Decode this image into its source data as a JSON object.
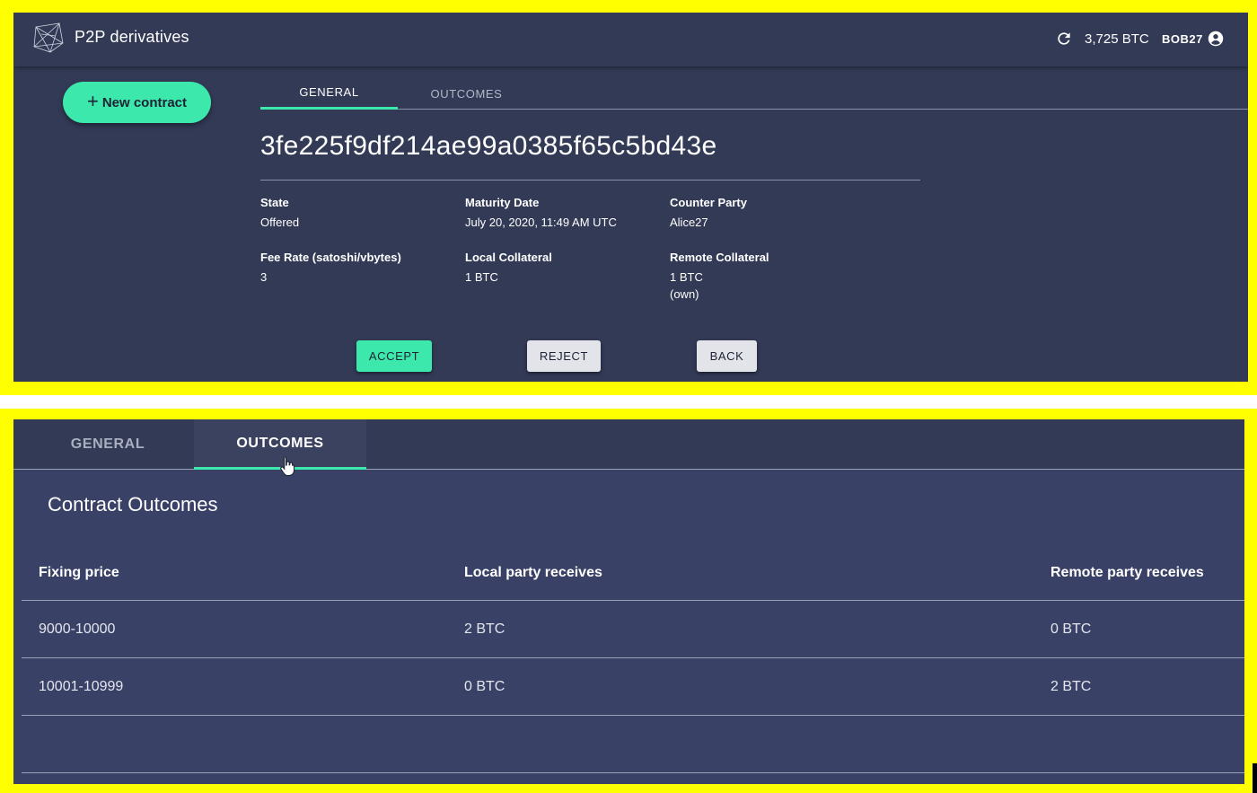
{
  "app": {
    "title": "P2P derivatives",
    "balance": "3,725 BTC",
    "username": "BOB27"
  },
  "sidebar": {
    "new_contract_label": "New contract"
  },
  "tabs": {
    "general": "GENERAL",
    "outcomes": "OUTCOMES"
  },
  "contract": {
    "id": "3fe225f9df214ae99a0385f65c5bd43e",
    "fields": {
      "state": {
        "label": "State",
        "value": "Offered"
      },
      "maturity": {
        "label": "Maturity Date",
        "value": "July 20, 2020, 11:49 AM UTC"
      },
      "counter_party": {
        "label": "Counter Party",
        "value": "Alice27"
      },
      "fee_rate": {
        "label": "Fee Rate (satoshi/vbytes)",
        "value": "3"
      },
      "local_collateral": {
        "label": "Local Collateral",
        "value": "1 BTC"
      },
      "remote_collateral": {
        "label": "Remote Collateral",
        "value": "1 BTC",
        "note": "(own)"
      }
    }
  },
  "actions": {
    "accept": "ACCEPT",
    "reject": "REJECT",
    "back": "BACK"
  },
  "outcomes": {
    "title": "Contract Outcomes",
    "columns": [
      "Fixing price",
      "Local party receives",
      "Remote party receives"
    ],
    "rows": [
      [
        "9000-10000",
        "2 BTC",
        "0 BTC"
      ],
      [
        "10001-10999",
        "0 BTC",
        "2 BTC"
      ]
    ]
  },
  "colors": {
    "accent": "#3de8ac",
    "panel_frame": "#ffff00",
    "background": "#333a56"
  }
}
